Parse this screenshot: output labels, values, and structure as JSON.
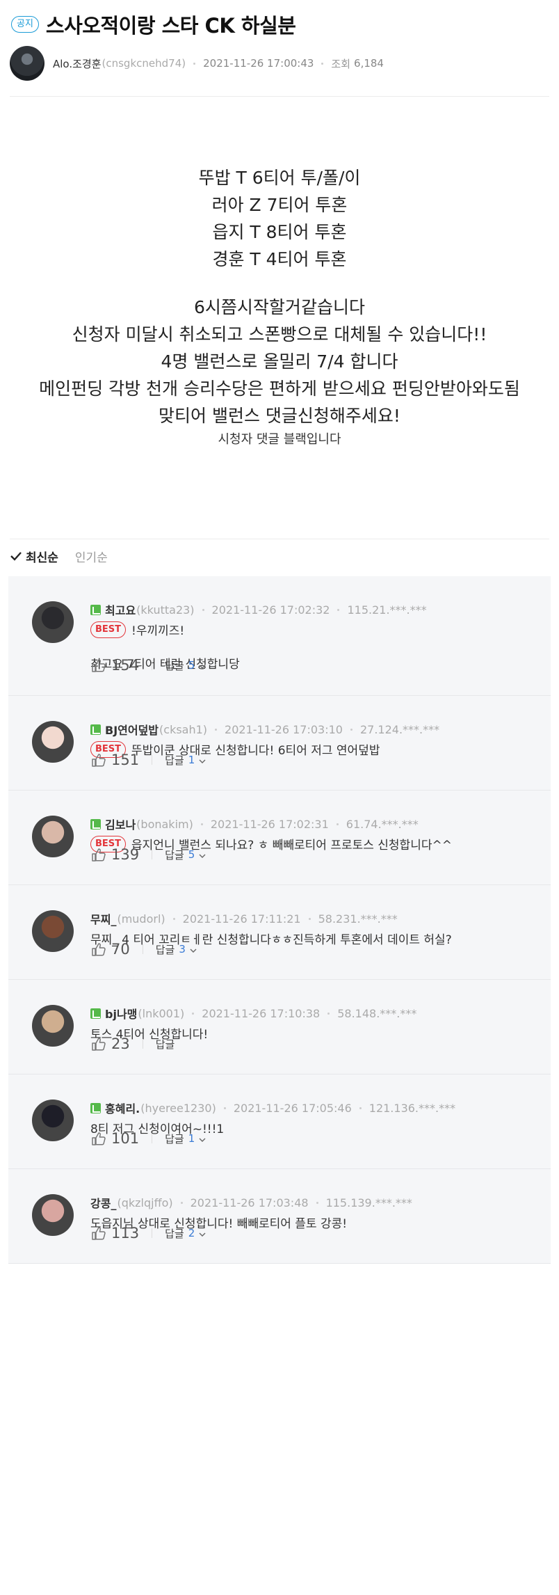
{
  "post": {
    "badge": "공지",
    "title": "스사오적이랑 스타 CK 하실분",
    "author_name": "Alo.조경훈",
    "author_id": "(cnsgkcnehd74)",
    "date": "2021-11-26 17:00:43",
    "views_label": "조회",
    "views": "6,184",
    "lines": [
      "뚜밥  T 6티어 투/폴/이",
      "러아  Z 7티어  투혼",
      "읍지  T 8티어 투혼",
      "경훈  T 4티어 투혼",
      "6시쯤시작할거같습니다",
      "신청자 미달시 취소되고 스폰빵으로 대체될 수 있습니다!!",
      "4명 밸런스로 올밀리 7/4 합니다",
      "메인펀딩 각방 천개 승리수당은 편하게 받으세요 펀딩안받아와도됨",
      "맞티어 밸런스 댓글신청해주세요!",
      "시청자 댓글 블랙입니다"
    ]
  },
  "sort": {
    "active": "최신순",
    "inactive": "인기순"
  },
  "reply_label": "답글",
  "best_label": "BEST",
  "comments": [
    {
      "nick": "최고요",
      "id": "(kkutta23)",
      "date": "2021-11-26 17:02:32",
      "ip": "115.21.***.***",
      "best": true,
      "text": "!우끼끼즈!",
      "text2": "최고요 7티어 테란 신청합니당",
      "likes": "154",
      "replies": "5",
      "fan": true
    },
    {
      "nick": "BJ연어덮밥",
      "id": "(cksah1)",
      "date": "2021-11-26 17:03:10",
      "ip": "27.124.***.***",
      "best": true,
      "text": "뚜밥이쿤 상대로 신청합니다! 6티어 저그 연어덮밥",
      "likes": "151",
      "replies": "1",
      "fan": true
    },
    {
      "nick": "김보나",
      "id": "(bonakim)",
      "date": "2021-11-26 17:02:31",
      "ip": "61.74.***.***",
      "best": true,
      "text": "읍지언니 밸런스 되나요? ㅎ 빼빼로티어 프로토스 신청합니다^^",
      "likes": "139",
      "replies": "5",
      "fan": true
    },
    {
      "nick": "무찌_",
      "id": "(mudorl)",
      "date": "2021-11-26 17:11:21",
      "ip": "58.231.***.***",
      "best": false,
      "text": "무찌_ 4 티어 꼬리ㅌㅔ란 신청합니다ㅎㅎ진득하게 투혼에서 데이트 허실?",
      "likes": "70",
      "replies": "3",
      "fan": false
    },
    {
      "nick": "bj나맹",
      "id": "(lnk001)",
      "date": "2021-11-26 17:10:38",
      "ip": "58.148.***.***",
      "best": false,
      "text": "토스 4티어 신청합니다!",
      "likes": "23",
      "replies": "",
      "fan": true
    },
    {
      "nick": "홍혜리.",
      "id": "(hyeree1230)",
      "date": "2021-11-26 17:05:46",
      "ip": "121.136.***.***",
      "best": false,
      "text": "8티 저그 신청이여어~!!!1",
      "likes": "101",
      "replies": "1",
      "fan": true
    },
    {
      "nick": "강콩_",
      "id": "(qkzlqjffo)",
      "date": "2021-11-26 17:03:48",
      "ip": "115.139.***.***",
      "best": false,
      "text": "도읍지님 상대로 신청합니다! 빼빼로티어 플토 강콩!",
      "likes": "113",
      "replies": "2",
      "fan": false
    }
  ],
  "avatar_colors": [
    "#2a2a2e",
    "#f2d9cf",
    "#d9b8a8",
    "#7a4a35",
    "#cfae8f",
    "#1e1e28",
    "#d8a6a0"
  ],
  "accent": "#3a7bd5",
  "best_color": "#e3353a",
  "notice_color": "#1a9bd7"
}
